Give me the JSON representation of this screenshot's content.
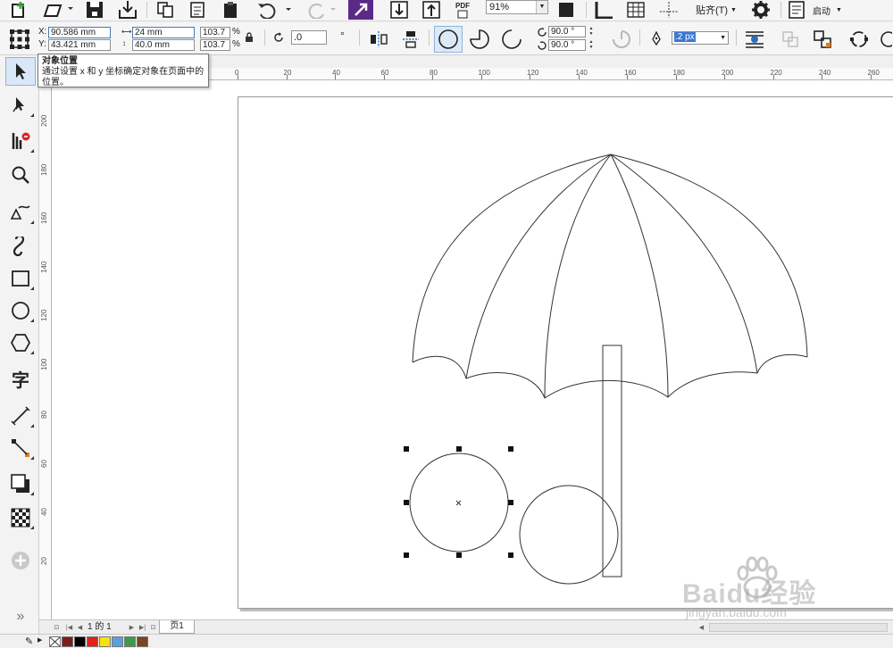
{
  "toolbar": {
    "zoom_value": "91%",
    "snap_label": "贴齐(T)",
    "launch_label": "启动",
    "pdf_label": "PDF"
  },
  "property_bar": {
    "x_label": "X:",
    "x_value": "90.586 mm",
    "y_label": "Y:",
    "y_value": "43.421 mm",
    "width_value": "24 mm",
    "height_value": "40.0 mm",
    "scale_w": "103.7",
    "scale_h": "103.7",
    "percent_sign": "%",
    "rotation_value": ".0",
    "degree_sign": "°",
    "start_angle": "90.0 °",
    "end_angle": "90.0 °",
    "outline_width": ".2 px"
  },
  "tooltip": {
    "title": "对象位置",
    "description": "通过设置 x 和 y 坐标确定对象在页面中的位置。"
  },
  "rulers": {
    "horizontal": [
      "0",
      "20",
      "40",
      "60",
      "80",
      "100",
      "120",
      "140",
      "160",
      "180",
      "200",
      "220",
      "240",
      "260"
    ],
    "vertical": [
      "200",
      "180",
      "160",
      "140",
      "120",
      "100",
      "80",
      "60",
      "40",
      "20"
    ]
  },
  "page_nav": {
    "counter_current": "1",
    "counter_sep": "的",
    "counter_total": "1",
    "page_tab": "页1"
  },
  "palette": {
    "colors": [
      "#7b1e1e",
      "#000000",
      "#e32119",
      "#f7e400",
      "#5aa0de",
      "#3c9b46",
      "#7a4428"
    ]
  },
  "watermark": {
    "brand": "Baidu经验",
    "url": "jingyan.baidu.com"
  }
}
